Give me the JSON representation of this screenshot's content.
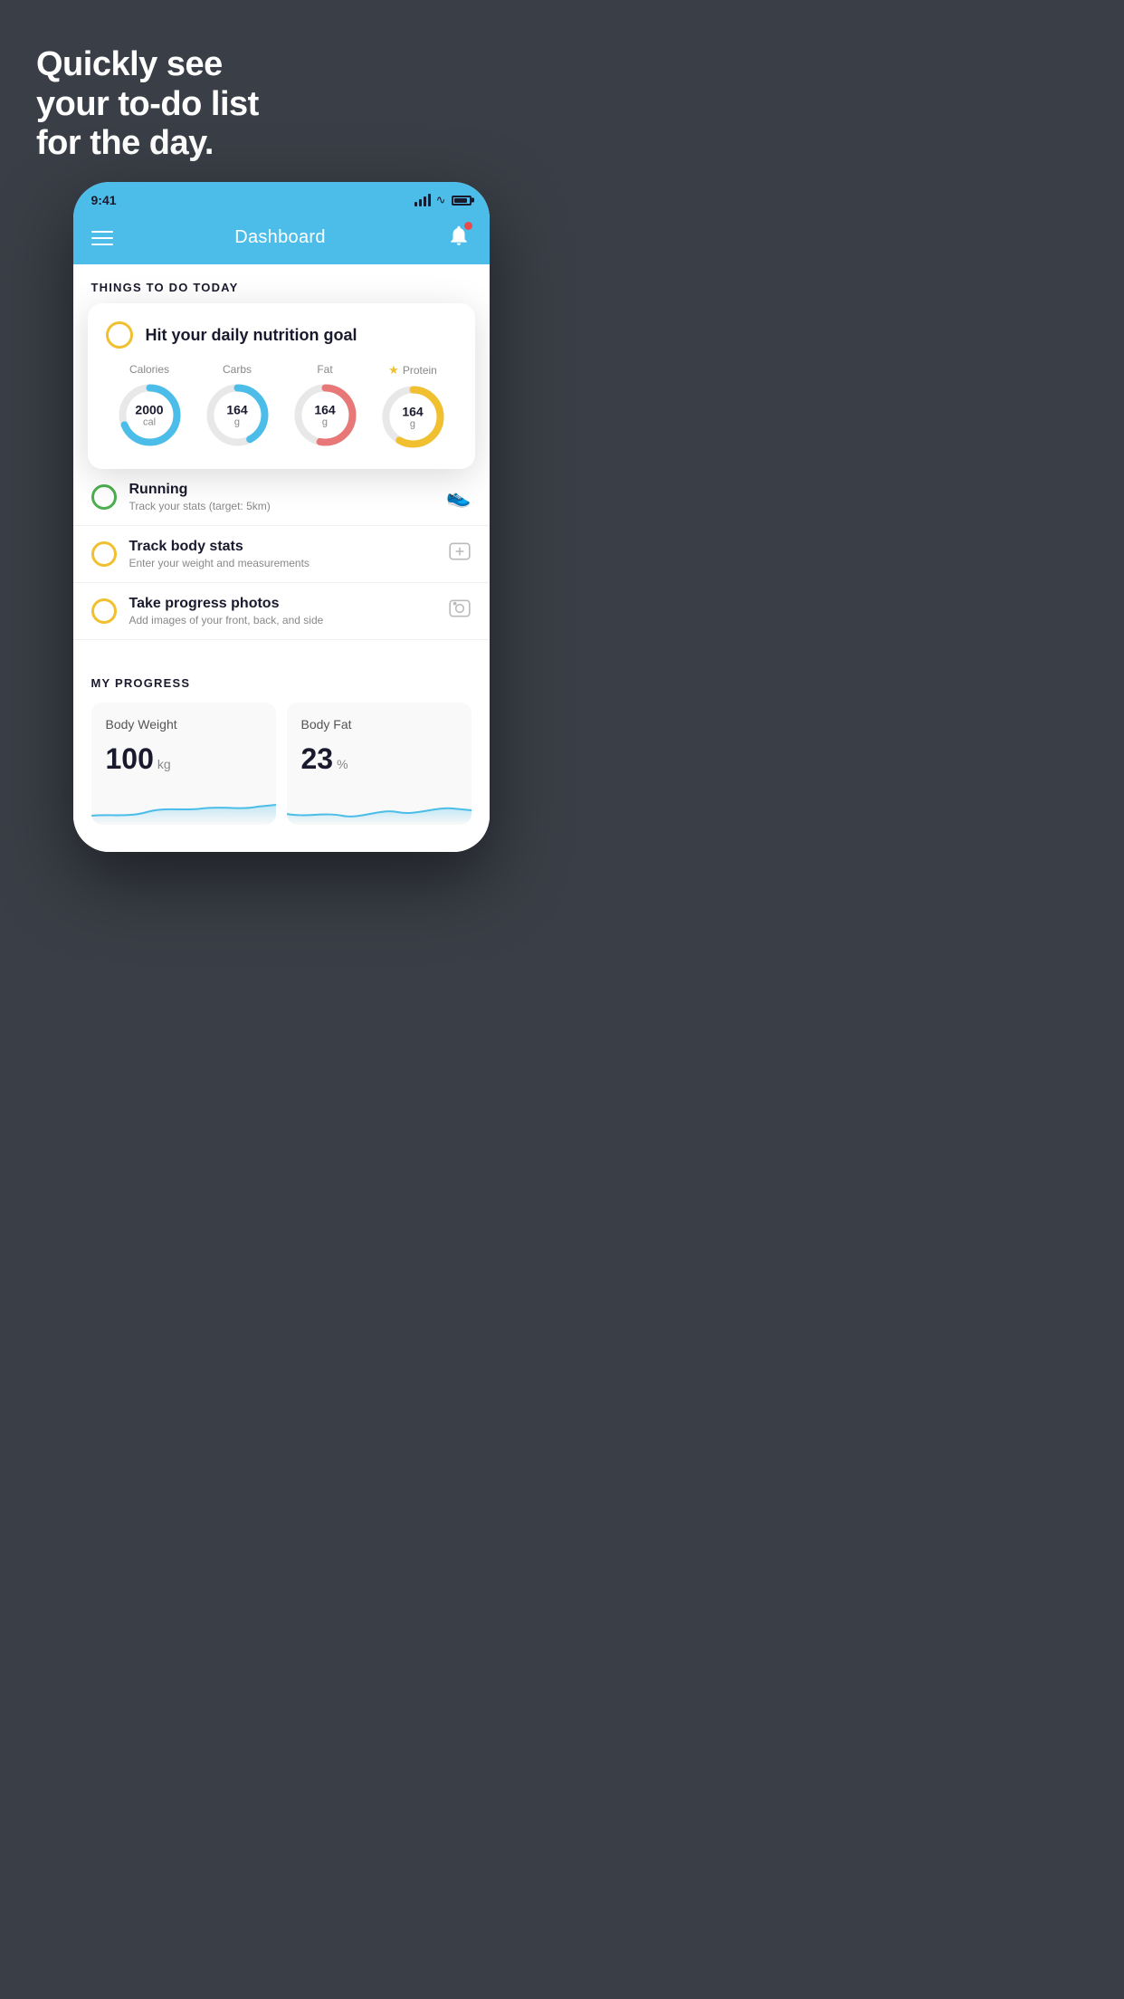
{
  "hero": {
    "title_line1": "Quickly see",
    "title_line2": "your to-do list",
    "title_line3": "for the day."
  },
  "status_bar": {
    "time": "9:41"
  },
  "header": {
    "title": "Dashboard"
  },
  "things_section": {
    "label": "THINGS TO DO TODAY"
  },
  "nutrition_card": {
    "check_label": "Hit your daily nutrition goal",
    "items": [
      {
        "label": "Calories",
        "value": "2000",
        "unit": "cal",
        "color": "blue",
        "star": false
      },
      {
        "label": "Carbs",
        "value": "164",
        "unit": "g",
        "color": "blue",
        "star": false
      },
      {
        "label": "Fat",
        "value": "164",
        "unit": "g",
        "color": "pink",
        "star": false
      },
      {
        "label": "Protein",
        "value": "164",
        "unit": "g",
        "color": "yellow",
        "star": true
      }
    ]
  },
  "todo_items": [
    {
      "title": "Running",
      "subtitle": "Track your stats (target: 5km)",
      "circle_color": "green",
      "icon": "shoe"
    },
    {
      "title": "Track body stats",
      "subtitle": "Enter your weight and measurements",
      "circle_color": "yellow",
      "icon": "scale"
    },
    {
      "title": "Take progress photos",
      "subtitle": "Add images of your front, back, and side",
      "circle_color": "yellow",
      "icon": "photo"
    }
  ],
  "progress_section": {
    "label": "MY PROGRESS",
    "cards": [
      {
        "title": "Body Weight",
        "value": "100",
        "unit": "kg"
      },
      {
        "title": "Body Fat",
        "value": "23",
        "unit": "%"
      }
    ]
  }
}
